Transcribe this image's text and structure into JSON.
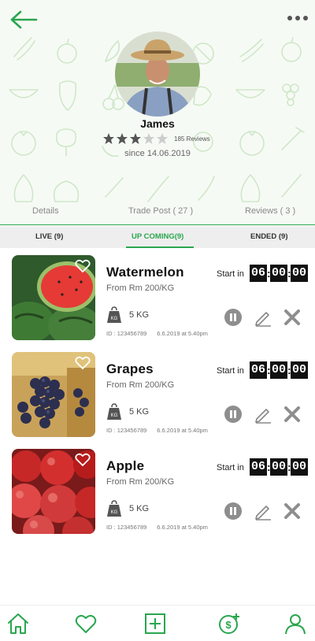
{
  "colors": {
    "brand_green": "#2aa64f",
    "timer_bg": "#111111",
    "icon_gray": "#8e8e8e",
    "header_bg": "#f6faf4",
    "star_filled": "#555555",
    "star_empty": "#cccccc"
  },
  "header": {
    "back_icon": "arrow-left-icon",
    "more_icon": "more-dots-icon",
    "profile": {
      "name": "James",
      "rating": 3,
      "max_rating": 5,
      "reviews": "185 Reviews",
      "since": "since 14.06.2019"
    }
  },
  "profile_tabs": [
    {
      "label": "Details"
    },
    {
      "label": "Trade Post ( 27 )",
      "active": true
    },
    {
      "label": "Reviews  ( 3 )"
    }
  ],
  "status_tabs": [
    {
      "label": "LIVE (9)"
    },
    {
      "label": "UP COMING(9)",
      "active": true
    },
    {
      "label": "ENDED (9)"
    }
  ],
  "products": [
    {
      "name": "Watermelon",
      "price": "From Rm 200/KG",
      "weight": "5 KG",
      "weight_icon_label": "KG",
      "id_text": "ID : 123456789",
      "date": "6.6.2019 at 5.40pm",
      "start_label": "Start in",
      "timer": {
        "h": "06",
        "m": "00",
        "s": "00"
      }
    },
    {
      "name": "Grapes",
      "price": "From Rm 200/KG",
      "weight": "5 KG",
      "weight_icon_label": "KG",
      "id_text": "ID : 123456789",
      "date": "6.6.2019 at 5.40pm",
      "start_label": "Start in",
      "timer": {
        "h": "06",
        "m": "00",
        "s": "00"
      }
    },
    {
      "name": "Apple",
      "price": "From Rm 200/KG",
      "weight": "5 KG",
      "weight_icon_label": "KG",
      "id_text": "ID : 123456789",
      "date": "6.6.2019 at 5.40pm",
      "start_label": "Start in",
      "timer": {
        "h": "06",
        "m": "00",
        "s": "00"
      }
    }
  ],
  "bottom_nav": [
    {
      "icon": "home-icon"
    },
    {
      "icon": "heart-icon"
    },
    {
      "icon": "add-square-icon"
    },
    {
      "icon": "dollar-plus-icon"
    },
    {
      "icon": "user-icon"
    }
  ]
}
